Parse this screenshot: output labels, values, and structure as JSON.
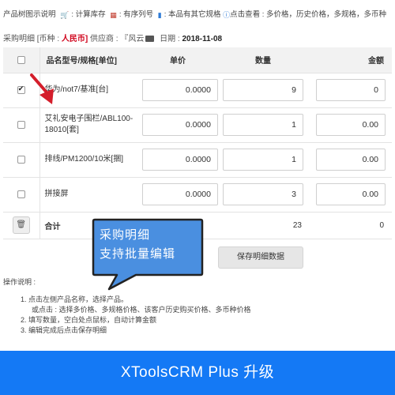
{
  "legend": {
    "title": "产品树图示说明",
    "stock": ": 计算库存",
    "serial": ": 有序列号",
    "variant": ": 本品有其它规格",
    "info": "点击查看 : 多价格，历史价格，多规格，多币种"
  },
  "header": {
    "title": "采购明细",
    "currency_label": "[币种 :",
    "currency": "人民币]",
    "supplier_label": "供应商 :",
    "supplier": "『风云",
    "date_label": "日期 :",
    "date": "2018-11-08"
  },
  "table": {
    "columns": {
      "name": "品名型号/规格[单位]",
      "price": "单价",
      "qty": "数量",
      "amount": "金额"
    },
    "rows": [
      {
        "name": "华为/not7/基准[台]",
        "price": "0.0000",
        "qty": "9",
        "amount": "0",
        "checked": true
      },
      {
        "name": "艾礼安电子围栏/ABL100-18010[套]",
        "price": "0.0000",
        "qty": "1",
        "amount": "0.00",
        "checked": false
      },
      {
        "name": "排线/PM1200/10米[捆]",
        "price": "0.0000",
        "qty": "1",
        "amount": "0.00",
        "checked": false
      },
      {
        "name": "拼接屏",
        "price": "0.0000",
        "qty": "3",
        "amount": "0.00",
        "checked": false
      }
    ],
    "total": {
      "label": "合计",
      "qty": "23",
      "amount": "0"
    }
  },
  "callout": {
    "line1": "采购明细",
    "line2": "支持批量编辑"
  },
  "save_button": "保存明细数据",
  "instructions": {
    "title": "操作说明 :",
    "step1": "1. 点击左侧产品名称，选择产品。",
    "step1_sub": "或点击 : 选择多价格、多规格价格、该客户历史购买价格、多币种价格",
    "step2": "2. 填写数量，空白处点鼠标，自动计算金额",
    "step3": "3. 编辑完成后点击保存明细"
  },
  "footer": "XToolsCRM Plus   升级",
  "colors": {
    "accent": "#1479f5",
    "callout": "#4a8fe0",
    "arrow": "#d41e2b",
    "currency": "#d0021b"
  }
}
